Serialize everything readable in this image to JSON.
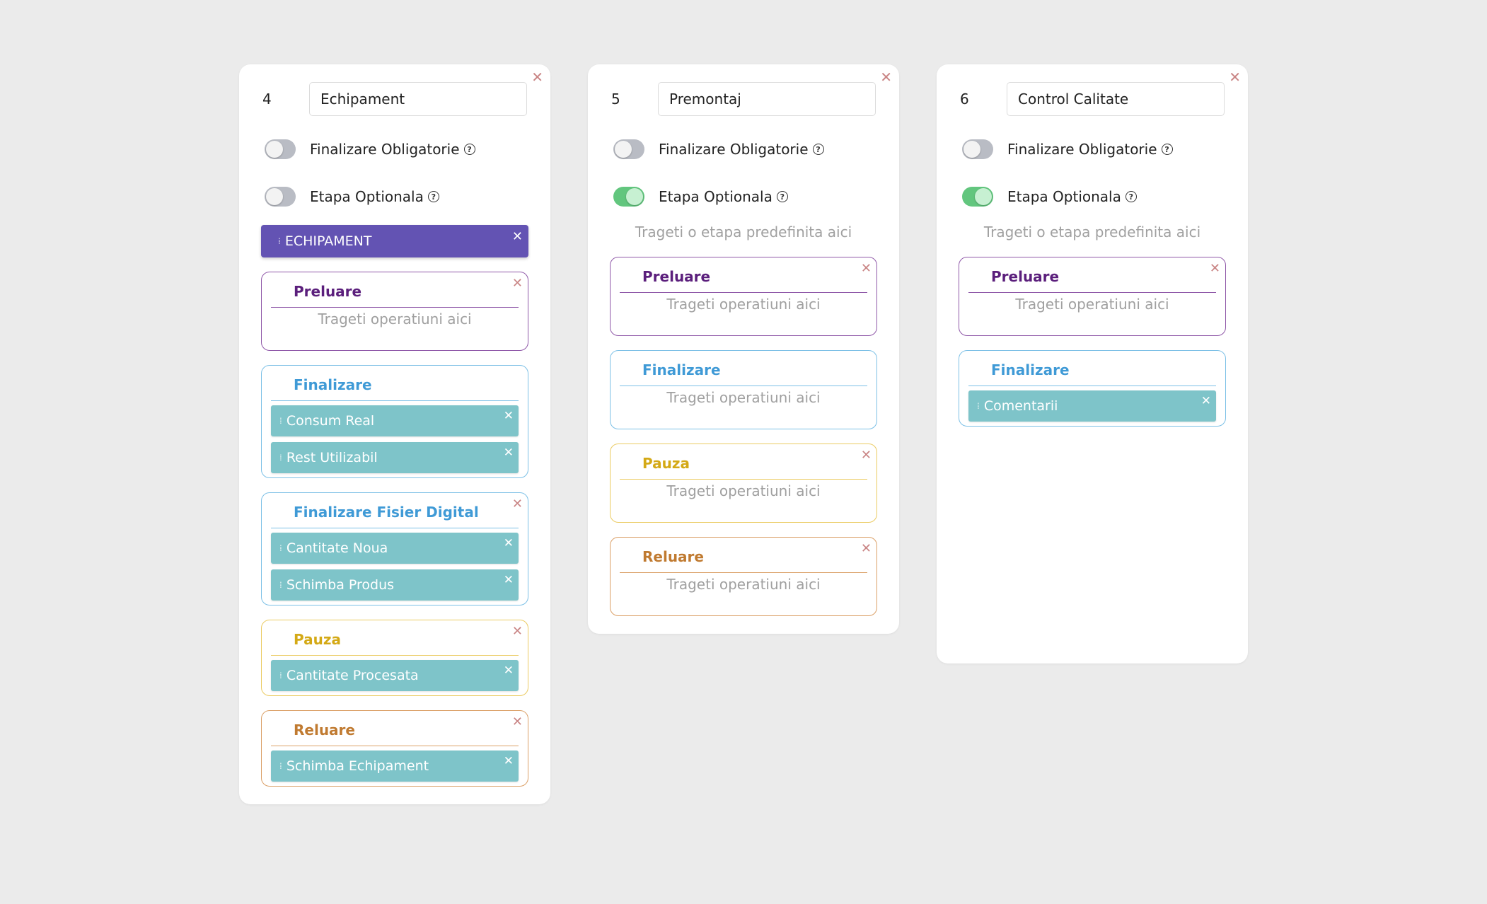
{
  "stages": [
    {
      "number": "4",
      "name": "Echipament",
      "mandatory_label": "Finalizare Obligatorie",
      "mandatory_on": false,
      "optional_label": "Etapa Optionala",
      "optional_on": false,
      "stage_chip": "ECHIPAMENT",
      "groups": [
        {
          "type": "preluare",
          "title": "Preluare",
          "closable": true,
          "hint": "Trageti operatiuni aici",
          "items": []
        },
        {
          "type": "finalizare",
          "title": "Finalizare",
          "closable": false,
          "hint": "",
          "items": [
            "Consum Real",
            "Rest Utilizabil"
          ]
        },
        {
          "type": "finalizare",
          "title": "Finalizare Fisier Digital",
          "closable": true,
          "hint": "",
          "items": [
            "Cantitate Noua",
            "Schimba Produs"
          ]
        },
        {
          "type": "pauza",
          "title": "Pauza",
          "closable": true,
          "hint": "",
          "items": [
            "Cantitate Procesata"
          ]
        },
        {
          "type": "reluare",
          "title": "Reluare",
          "closable": true,
          "hint": "",
          "items": [
            "Schimba Echipament"
          ]
        }
      ]
    },
    {
      "number": "5",
      "name": "Premontaj",
      "mandatory_label": "Finalizare Obligatorie",
      "mandatory_on": false,
      "optional_label": "Etapa Optionala",
      "optional_on": true,
      "drop_hint": "Trageti o etapa predefinita aici",
      "groups": [
        {
          "type": "preluare",
          "title": "Preluare",
          "closable": true,
          "hint": "Trageti operatiuni aici",
          "items": []
        },
        {
          "type": "finalizare",
          "title": "Finalizare",
          "closable": false,
          "hint": "Trageti operatiuni aici",
          "items": []
        },
        {
          "type": "pauza",
          "title": "Pauza",
          "closable": true,
          "hint": "Trageti operatiuni aici",
          "items": []
        },
        {
          "type": "reluare",
          "title": "Reluare",
          "closable": true,
          "hint": "Trageti operatiuni aici",
          "items": []
        }
      ]
    },
    {
      "number": "6",
      "name": "Control Calitate",
      "mandatory_label": "Finalizare Obligatorie",
      "mandatory_on": false,
      "optional_label": "Etapa Optionala",
      "optional_on": true,
      "drop_hint": "Trageti o etapa predefinita aici",
      "groups": [
        {
          "type": "preluare",
          "title": "Preluare",
          "closable": true,
          "hint": "Trageti operatiuni aici",
          "items": []
        },
        {
          "type": "finalizare",
          "title": "Finalizare",
          "closable": false,
          "hint": "",
          "items": [
            "Comentarii"
          ]
        }
      ]
    }
  ],
  "icons": {
    "close": "close-icon",
    "help": "help-circle-icon",
    "grip": "drag-handle-icon"
  },
  "colors": {
    "stage_chip": "#6353b3",
    "operation": "#7ec4c9",
    "toggle_on": "#62c67e",
    "preluare": "#5b1f7c",
    "finalizare": "#3f9ad6",
    "pauza": "#d4a916",
    "reluare": "#c07a30"
  }
}
